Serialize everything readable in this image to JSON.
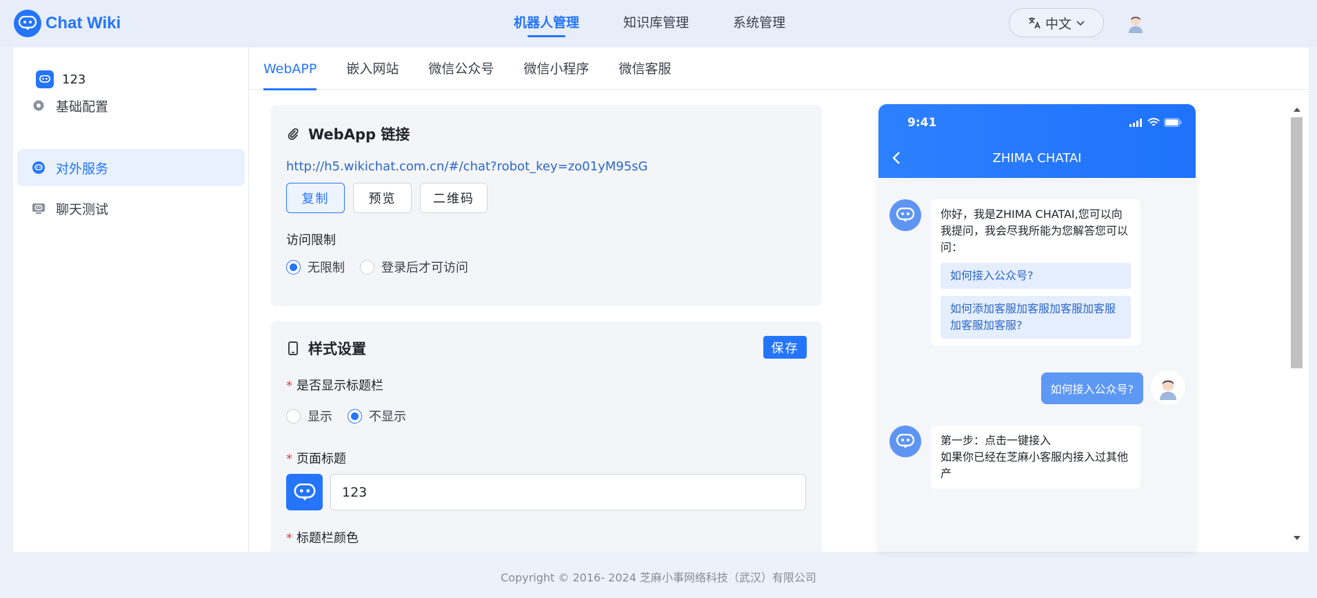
{
  "brand": {
    "name": "Chat Wiki"
  },
  "topnav": {
    "items": [
      {
        "label": "机器人管理",
        "active": true
      },
      {
        "label": "知识库管理",
        "active": false
      },
      {
        "label": "系统管理",
        "active": false
      }
    ],
    "language": "中文"
  },
  "sidebar": {
    "robot_name": "123",
    "items": [
      {
        "label": "基础配置",
        "icon": "gear-icon"
      },
      {
        "label": "对外服务",
        "icon": "service-icon",
        "active": true
      },
      {
        "label": "聊天测试",
        "icon": "chat-test-icon"
      }
    ]
  },
  "tabs": [
    "WebAPP",
    "嵌入网站",
    "微信公众号",
    "微信小程序",
    "微信客服"
  ],
  "webapp_card": {
    "title": "WebApp 链接",
    "url": "http://h5.wikichat.com.cn/#/chat?robot_key=zo01yM95sG",
    "buttons": {
      "copy": "复制",
      "preview": "预览",
      "qrcode": "二维码"
    },
    "access_label": "访问限制",
    "access_options": [
      "无限制",
      "登录后才可访问"
    ],
    "access_selected": "无限制"
  },
  "style_card": {
    "title": "样式设置",
    "save_label": "保存",
    "show_titlebar_label": "是否显示标题栏",
    "titlebar_options": [
      "显示",
      "不显示"
    ],
    "titlebar_selected": "不显示",
    "page_title_label": "页面标题",
    "page_title_value": "123",
    "titlebar_color_label": "标题栏颜色"
  },
  "phone": {
    "time": "9:41",
    "title": "ZHIMA CHATAI",
    "greeting": "你好，我是ZHIMA CHATAI,您可以向我提问，我会尽我所能为您解答您可以问：",
    "suggestions": [
      "如何接入公众号?",
      "如何添加客服加客服加客服加客服加客服加客服?"
    ],
    "user_message": "如何接入公众号?",
    "reply_line1": "第一步：点击一键接入",
    "reply_line2": "如果你已经在芝麻小客服内接入过其他产"
  },
  "footer": {
    "copyright": "Copyright © 2016- 2024 芝麻小事网络科技（武汉）有限公司"
  },
  "colors": {
    "accent": "#2475fc",
    "required": "#e63b3b"
  }
}
